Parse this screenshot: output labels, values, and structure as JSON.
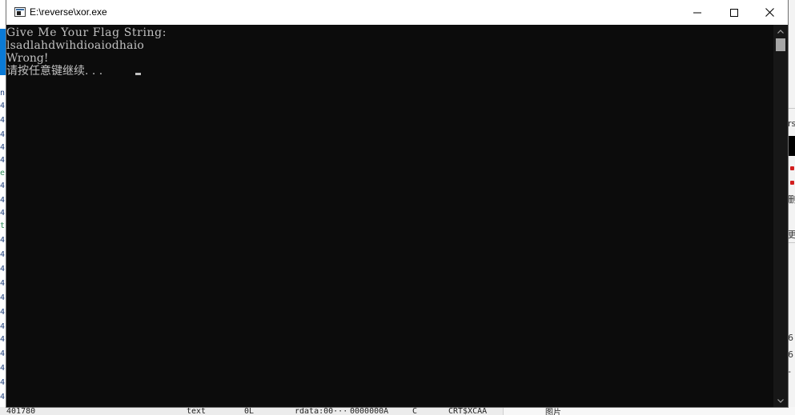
{
  "window": {
    "title": "E:\\reverse\\xor.exe",
    "controls": {
      "minimize": "minimize-icon",
      "maximize": "maximize-icon",
      "close": "close-icon"
    }
  },
  "console": {
    "lines": [
      "Give Me Your Flag String:",
      "lsadlahdwihdioaiodhaio",
      "Wrong!",
      "请按任意键继续. . . "
    ],
    "text_color": "#c0c0c0",
    "background": "#0c0c0c"
  },
  "background_peek": {
    "bottom_items": [
      "_401780",
      "text",
      "0L",
      "rdata:00···",
      "0000000A",
      "C",
      "CRT$XCAA",
      "图片"
    ],
    "right_items": [
      "rs",
      "删",
      "更",
      "6",
      "6",
      "-"
    ]
  }
}
